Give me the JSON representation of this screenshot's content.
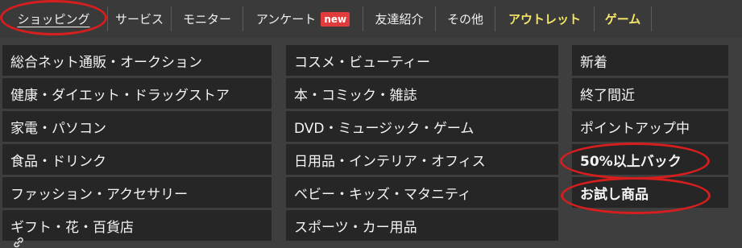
{
  "tabs": [
    {
      "label": "ショッピング",
      "active": true
    },
    {
      "label": "サービス"
    },
    {
      "label": "モニター"
    },
    {
      "label": "アンケート",
      "badge": "new"
    },
    {
      "label": "友達紹介"
    },
    {
      "label": "その他"
    },
    {
      "label": "アウトレット",
      "highlight": true
    },
    {
      "label": "ゲーム",
      "highlight": true
    }
  ],
  "columns": {
    "col1": [
      "総合ネット通販・オークション",
      "健康・ダイエット・ドラッグストア",
      "家電・パソコン",
      "食品・ドリンク",
      "ファッション・アクセサリー",
      "ギフト・花・百貨店"
    ],
    "col2": [
      "コスメ・ビューティー",
      "本・コミック・雑誌",
      "DVD・ミュージック・ゲーム",
      "日用品・インテリア・オフィス",
      "ベビー・キッズ・マタニティ",
      "スポーツ・カー用品"
    ],
    "col3": [
      "新着",
      "終了間近",
      "ポイントアップ中",
      "50%以上バック",
      "お試し商品"
    ]
  },
  "colors": {
    "background": "#3e3e3e",
    "menu_item_bg": "#262626",
    "highlight_text": "#f5e56b",
    "badge_bg": "#e23b3b",
    "annotation_red": "#d61e1e"
  },
  "icons": {
    "corner": "link-icon"
  }
}
